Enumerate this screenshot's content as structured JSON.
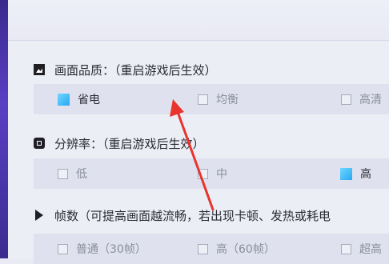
{
  "sections": [
    {
      "title": "画面品质：（重启游戏后生效）",
      "icon": "image-quality-icon",
      "options": [
        {
          "label": "省电",
          "selected": true
        },
        {
          "label": "均衡",
          "selected": false
        },
        {
          "label": "高清",
          "selected": false
        }
      ]
    },
    {
      "title": "分辨率：（重启游戏后生效）",
      "icon": "resolution-icon",
      "options": [
        {
          "label": "低",
          "selected": false
        },
        {
          "label": "中",
          "selected": false
        },
        {
          "label": "高",
          "selected": true
        }
      ]
    },
    {
      "title": "帧数（可提高画面越流畅，若出现卡顿、发热或耗电",
      "icon": "framerate-icon",
      "options": [
        {
          "label": "普通（30帧）",
          "selected": false
        },
        {
          "label": "高（60帧）",
          "selected": false
        },
        {
          "label": "超高",
          "selected": false
        }
      ]
    }
  ],
  "colors": {
    "accent": "#2aa8f2",
    "annotation_arrow": "#e8342c",
    "sidebar": "#4a34b0"
  }
}
